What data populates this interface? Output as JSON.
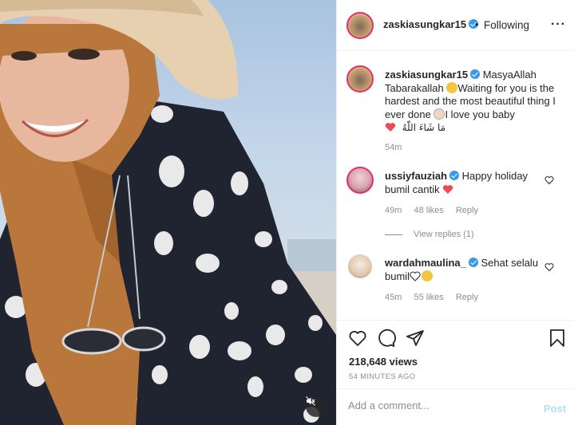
{
  "post": {
    "username": "zaskiasungkar15",
    "follow_dot": "•",
    "follow_status": "Following",
    "more": "···"
  },
  "caption": {
    "username": "zaskiasungkar15",
    "text_1": "MasyaAllah Tabarakallah",
    "text_2": "Waiting for you is the hardest and the most beautiful thing I ever done",
    "text_3": "I love you baby",
    "arabic": "مَا شَاءَ اللّٰهُ",
    "time": "54m"
  },
  "comments": [
    {
      "username": "ussiyfauziah",
      "text": "Happy holiday bumil cantik",
      "time": "49m",
      "likes": "48 likes",
      "reply": "Reply",
      "view_replies": "View replies (1)"
    },
    {
      "username": "wardahmaulina_",
      "text": "Sehat selalu bumil",
      "time": "45m",
      "likes": "55 likes",
      "reply": "Reply"
    }
  ],
  "stats": {
    "views": "218,648 views",
    "ago": "54 MINUTES AGO"
  },
  "add_comment": {
    "placeholder": "Add a comment...",
    "post_label": "Post"
  },
  "colors": {
    "verified": "#3897f0",
    "post_disabled": "#b2dffc",
    "meta": "#8e8e8e",
    "heart_red": "#ed4956"
  },
  "icons": [
    "verified-icon",
    "more-icon",
    "heart-icon",
    "comment-icon",
    "share-icon",
    "bookmark-icon",
    "mute-icon"
  ]
}
